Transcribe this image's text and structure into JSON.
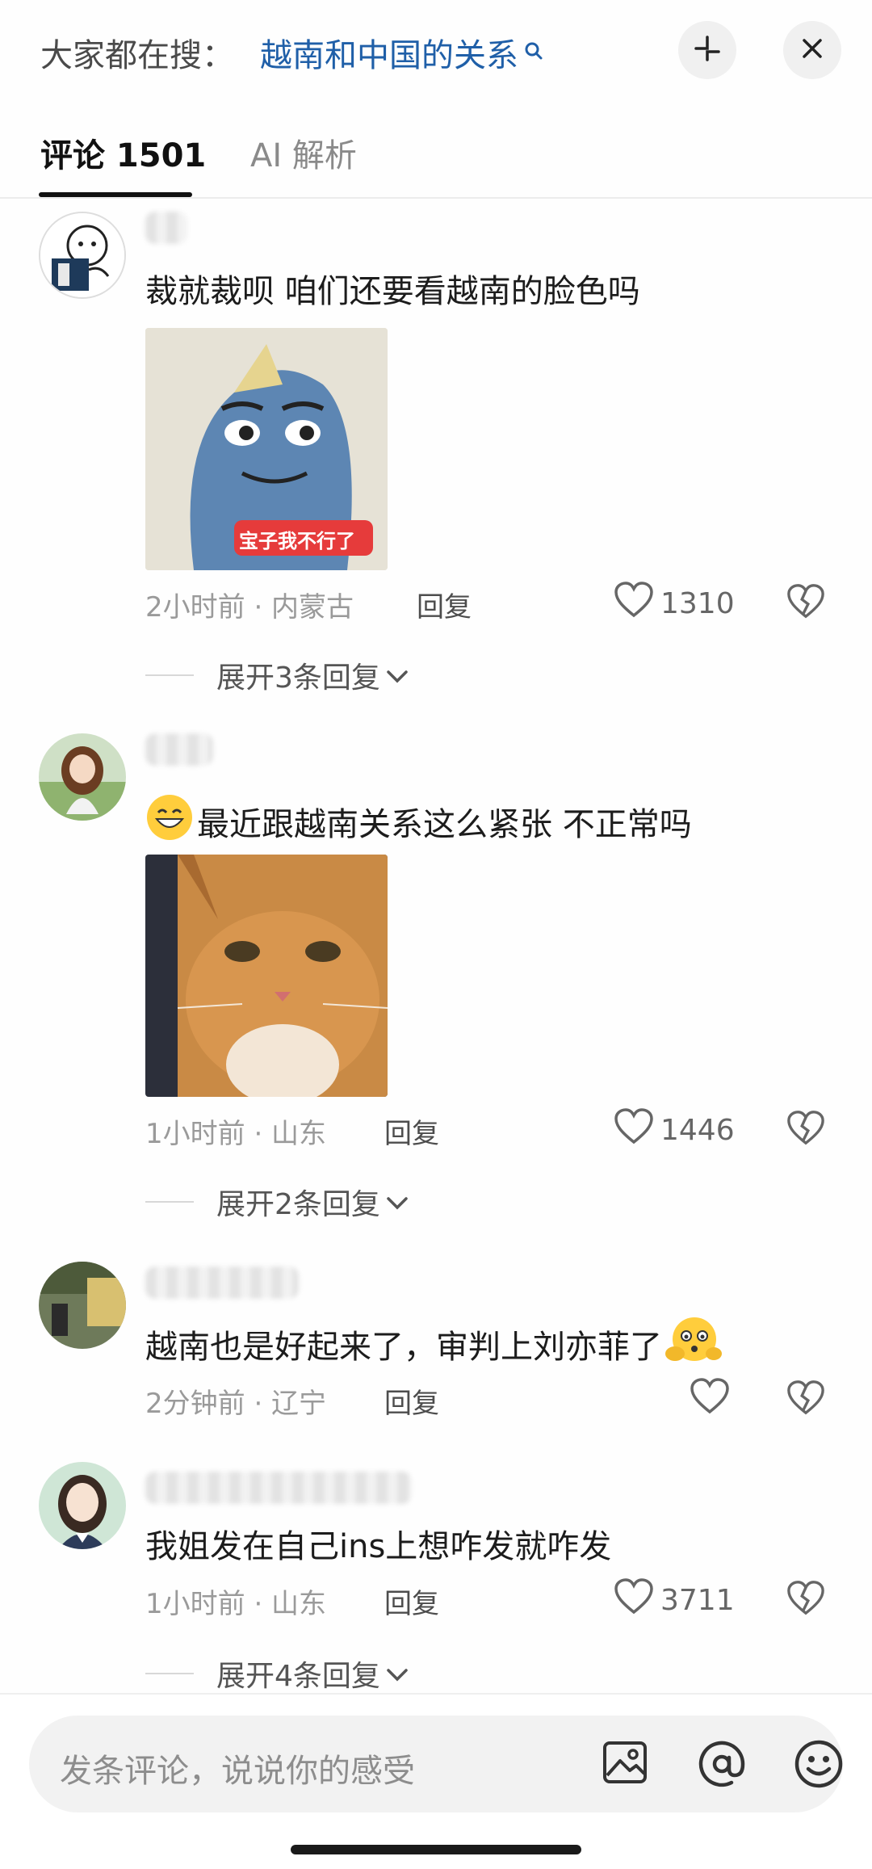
{
  "header": {
    "hot_prefix": "大家都在搜：",
    "hot_query": "越南和中国的关系"
  },
  "tabs": [
    {
      "label": "评论 1501",
      "active": true
    },
    {
      "label": "AI 解析",
      "active": false
    }
  ],
  "comments": [
    {
      "text": "裁就裁呗 咱们还要看越南的脸色吗",
      "image_sticker_text": "宝子我不行了",
      "time_location": "2小时前 · 内蒙古",
      "reply_label": "回复",
      "likes": "1310",
      "expand_label": "展开3条回复"
    },
    {
      "text": "最近跟越南关系这么紧张 不正常吗",
      "time_location": "1小时前 · 山东",
      "reply_label": "回复",
      "likes": "1446",
      "expand_label": "展开2条回复"
    },
    {
      "text": "越南也是好起来了，审判上刘亦菲了",
      "time_location": "2分钟前 · 辽宁",
      "reply_label": "回复",
      "likes": ""
    },
    {
      "text": "我姐发在自己ins上想咋发就咋发",
      "time_location": "1小时前 · 山东",
      "reply_label": "回复",
      "likes": "3711",
      "expand_label": "展开4条回复"
    }
  ],
  "input": {
    "placeholder": "发条评论，说说你的感受"
  },
  "colors": {
    "link": "#1f5fa8",
    "meta": "#9a9a9a",
    "text": "#1c1c1c"
  }
}
